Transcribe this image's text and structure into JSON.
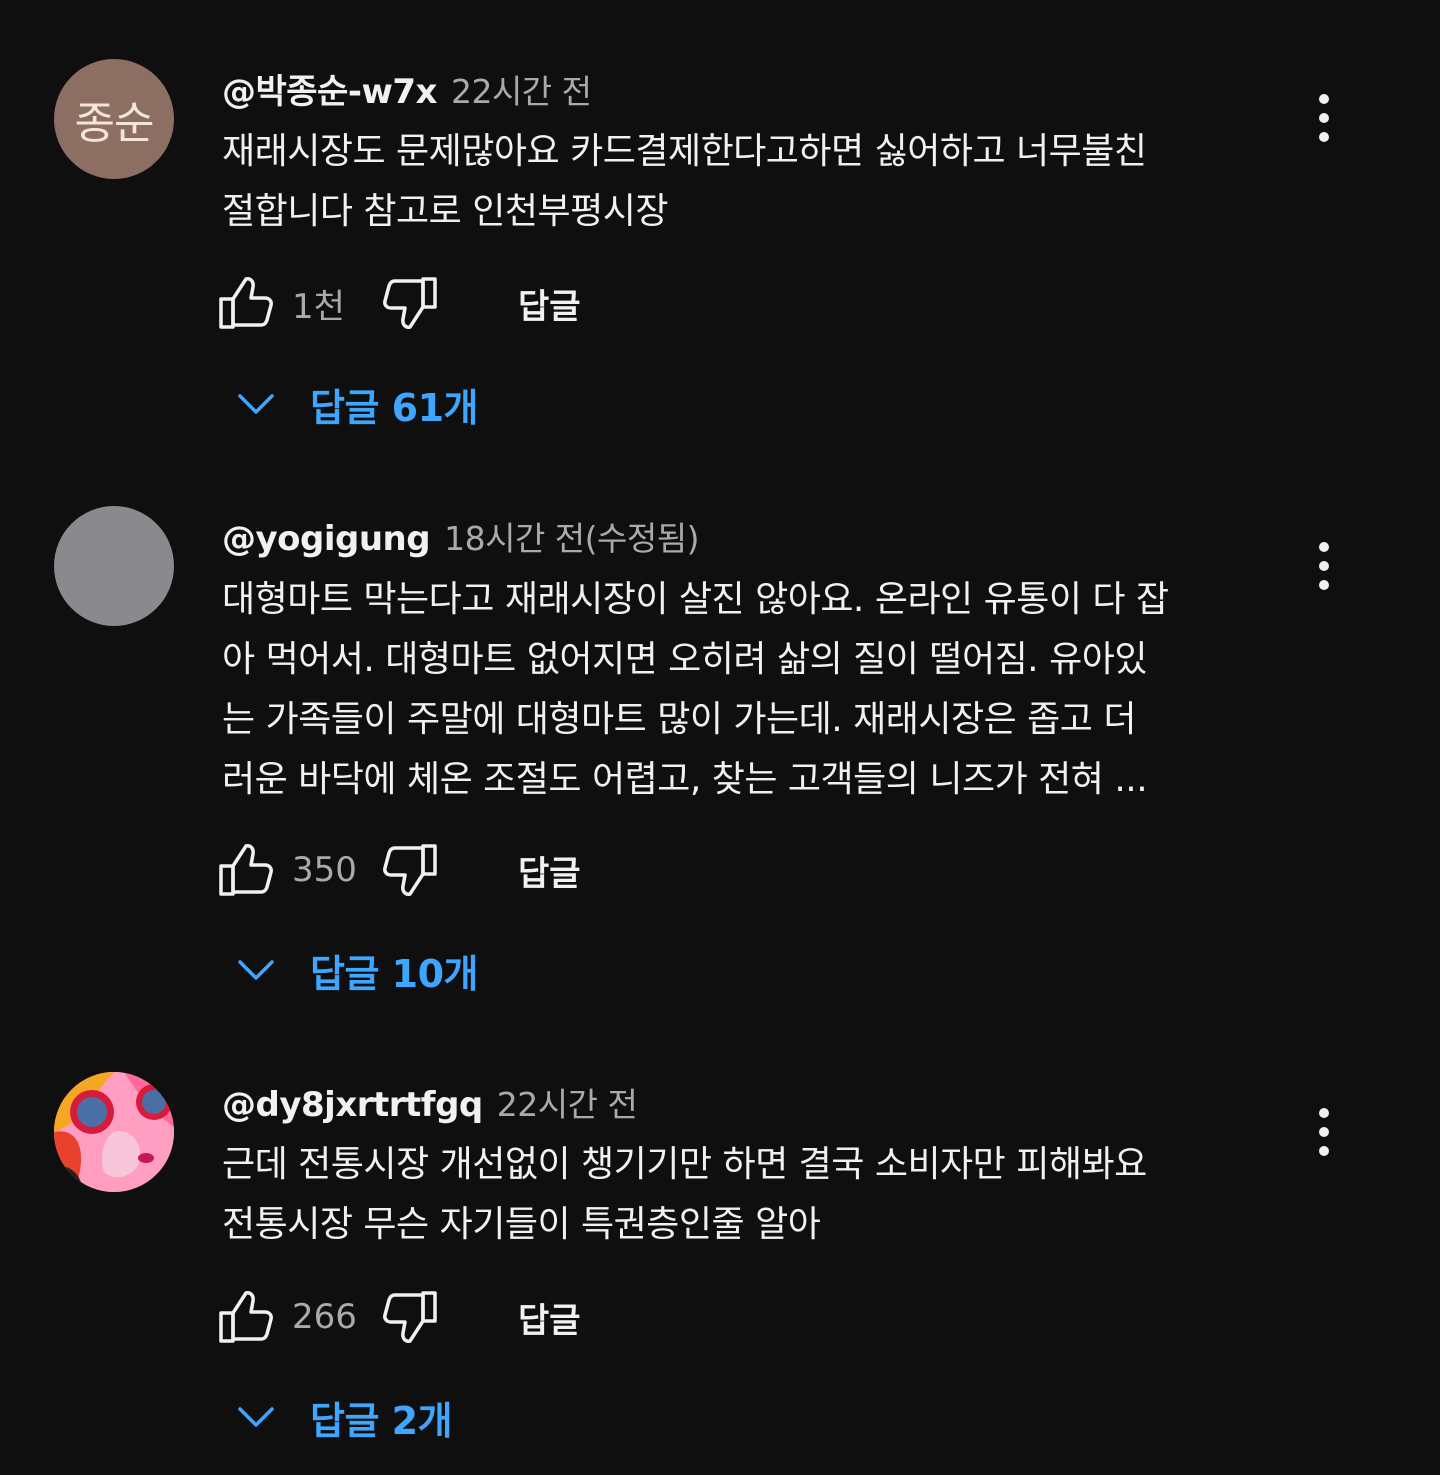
{
  "comments": [
    {
      "avatar_initials": "종순",
      "handle": "@박종순-w7x",
      "time": "22시간 전",
      "lines": [
        "재래시장도 문제많아요 카드결제한다고하면 싫어하고 너무불친",
        "절합니다  참고로 인천부평시장"
      ],
      "likes": "1천",
      "reply_label": "답글",
      "replies_label": "답글 61개"
    },
    {
      "avatar_initials": "",
      "handle": "@yogigung",
      "time": "18시간 전(수정됨)",
      "lines": [
        "대형마트 막는다고 재래시장이 살진 않아요.  온라인 유통이 다 잡",
        "아 먹어서.  대형마트 없어지면 오히려 삶의 질이 떨어짐.  유아있",
        "는 가족들이 주말에 대형마트 많이 가는데.  재래시장은  좁고 더",
        "러운 바닥에  체온 조절도 어렵고, 찾는 고객들의  니즈가 전혀 ..."
      ],
      "likes": "350",
      "reply_label": "답글",
      "replies_label": "답글 10개"
    },
    {
      "avatar_initials": "",
      "handle": "@dy8jxrtrtfgq",
      "time": "22시간 전",
      "lines": [
        "근데 전통시장 개선없이 챙기기만 하면 결국 소비자만 피해봐요",
        "전통시장 무슨 자기들이 특권층인줄 알아"
      ],
      "likes": "266",
      "reply_label": "답글",
      "replies_label": "답글 2개"
    }
  ],
  "icons": {
    "more": "more-vertical-icon",
    "like": "thumb-up-icon",
    "dislike": "thumb-down-icon",
    "expand": "chevron-down-icon"
  },
  "colors": {
    "background": "#0f0f0f",
    "text": "#f1f1f1",
    "secondary_text": "#aaaaaa",
    "link_blue": "#3ea6ff"
  }
}
